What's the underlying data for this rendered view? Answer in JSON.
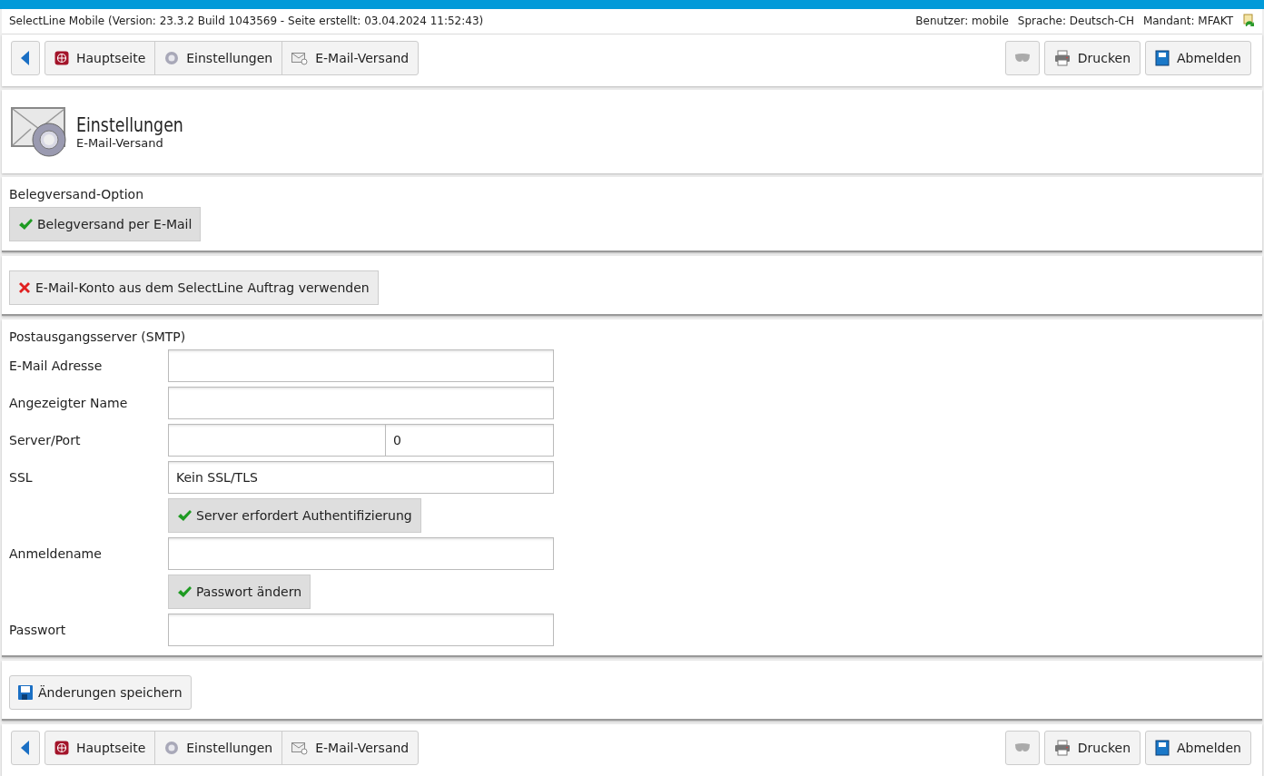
{
  "header": {
    "app_info": "SelectLine Mobile (Version: 23.3.2 Build 1043569 - Seite erstellt: 03.04.2024 11:52:43)",
    "user": "Benutzer: mobile",
    "language": "Sprache: Deutsch-CH",
    "client": "Mandant: MFAKT"
  },
  "toolbar_top": {
    "breadcrumbs": [
      {
        "kind": "home",
        "label": "Hauptseite"
      },
      {
        "kind": "settings",
        "label": "Einstellungen"
      },
      {
        "kind": "mail",
        "label": "E-Mail-Versand"
      }
    ],
    "actions": [
      {
        "kind": "mask"
      },
      {
        "kind": "print",
        "label": "Drucken"
      },
      {
        "kind": "logout",
        "label": "Abmelden"
      }
    ]
  },
  "page_title": {
    "title": "Einstellungen",
    "subtitle": "E-Mail-Versand"
  },
  "sections": [
    {
      "title": "Belegversand-Option",
      "rows": [
        {
          "kind": "toggle",
          "label": "Belegversand per E-Mail",
          "checked": true
        }
      ]
    },
    {
      "rows": [
        {
          "kind": "toggle",
          "label": "E-Mail-Konto aus dem SelectLine Auftrag verwenden",
          "checked": false
        }
      ]
    },
    {
      "title": "Postausgangsserver (SMTP)",
      "rows": [
        {
          "kind": "field",
          "label": "E-Mail Adresse"
        },
        {
          "kind": "field",
          "label": "Angezeigter Name"
        },
        {
          "kind": "split",
          "label": "Server/Port",
          "value2": "0"
        },
        {
          "kind": "field",
          "label": "SSL",
          "value": "Kein SSL/TLS"
        },
        {
          "kind": "toggle",
          "label": "Server erfordert Authentifizierung",
          "checked": true,
          "indent": true
        },
        {
          "kind": "field",
          "label": "Anmeldename"
        },
        {
          "kind": "toggle",
          "label": "Passwort ändern",
          "checked": true,
          "indent": true
        },
        {
          "kind": "field",
          "label": "Passwort"
        }
      ]
    },
    {
      "rows": [
        {
          "kind": "save",
          "label": "Änderungen speichern"
        }
      ]
    }
  ],
  "toolbar_bottom": {
    "breadcrumbs": [
      {
        "kind": "home",
        "label": "Hauptseite"
      },
      {
        "kind": "settings",
        "label": "Einstellungen"
      },
      {
        "kind": "mail",
        "label": "E-Mail-Versand"
      }
    ],
    "actions": [
      {
        "kind": "mask"
      },
      {
        "kind": "print",
        "label": "Drucken"
      },
      {
        "kind": "logout",
        "label": "Abmelden"
      }
    ]
  }
}
